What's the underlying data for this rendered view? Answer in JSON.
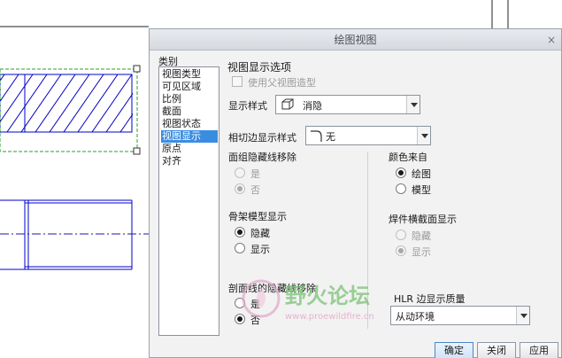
{
  "dialog": {
    "title": "绘图视图",
    "close_glyph": "×",
    "category_label": "类别",
    "categories": [
      "视图类型",
      "可见区域",
      "比例",
      "截面",
      "视图状态",
      "视图显示",
      "原点",
      "对齐"
    ],
    "selected_category": "视图显示",
    "section_title": "视图显示选项",
    "use_parent_style": {
      "label": "使用父视图造型",
      "checked": false,
      "enabled": false
    },
    "display_style": {
      "label": "显示样式",
      "value": "消隐"
    },
    "tangent_edge": {
      "label": "相切边显示样式",
      "value": "无"
    },
    "hidden_line_removal": {
      "label": "面组隐藏线移除",
      "options": [
        "是",
        "否"
      ],
      "selected": "否",
      "enabled": false
    },
    "skeleton_display": {
      "label": "骨架模型显示",
      "options": [
        "隐藏",
        "显示"
      ],
      "selected": "隐藏",
      "enabled": true
    },
    "xsec_hidden_line": {
      "label": "剖面线的隐藏线移除",
      "options": [
        "是",
        "否"
      ],
      "selected": "否",
      "enabled": true
    },
    "color_from": {
      "label": "颜色来自",
      "options": [
        "绘图",
        "模型"
      ],
      "selected": "绘图",
      "enabled": true
    },
    "weld_xsec_display": {
      "label": "焊件横截面显示",
      "options": [
        "隐藏",
        "显示"
      ],
      "selected": "显示",
      "enabled": false
    },
    "hlr_quality": {
      "label": "HLR 边显示质量",
      "value": "从动环境"
    },
    "buttons": {
      "ok": "确定",
      "close": "关闭",
      "apply": "应用"
    }
  },
  "watermark": {
    "text": "野火论坛",
    "url": "www.proewildfire.cn"
  },
  "colors": {
    "hatch": "#0000c8",
    "border_dash": "#2aa02a",
    "centerline": "#1a1aaa",
    "selection": "#3a8ce0"
  },
  "icons": {
    "display_style": "hidden-line-cube-icon",
    "tangent_edge": "tangent-edge-none-icon"
  }
}
